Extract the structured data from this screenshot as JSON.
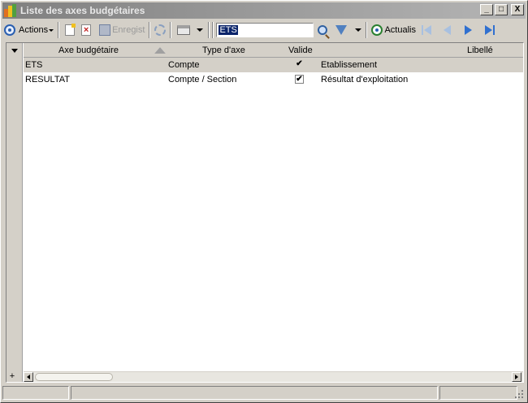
{
  "window": {
    "title": "Liste des axes budgétaires",
    "minimize": "_",
    "maximize": "□",
    "close": "X"
  },
  "toolbar": {
    "actions_label": "Actions",
    "save_label": "Enregist",
    "search_value": "ETS",
    "refresh_label": "Actualis"
  },
  "grid": {
    "columns": [
      "Axe budgétaire",
      "Type d'axe",
      "Valide",
      "Libellé"
    ],
    "rows": [
      {
        "axe": "ETS",
        "type": "Compte",
        "valide": "✔",
        "libelle": "Etablissement"
      },
      {
        "axe": "RESULTAT",
        "type": "Compte / Section",
        "valide": "✔",
        "libelle": "Résultat d'exploitation"
      }
    ],
    "add_symbol": "+"
  }
}
